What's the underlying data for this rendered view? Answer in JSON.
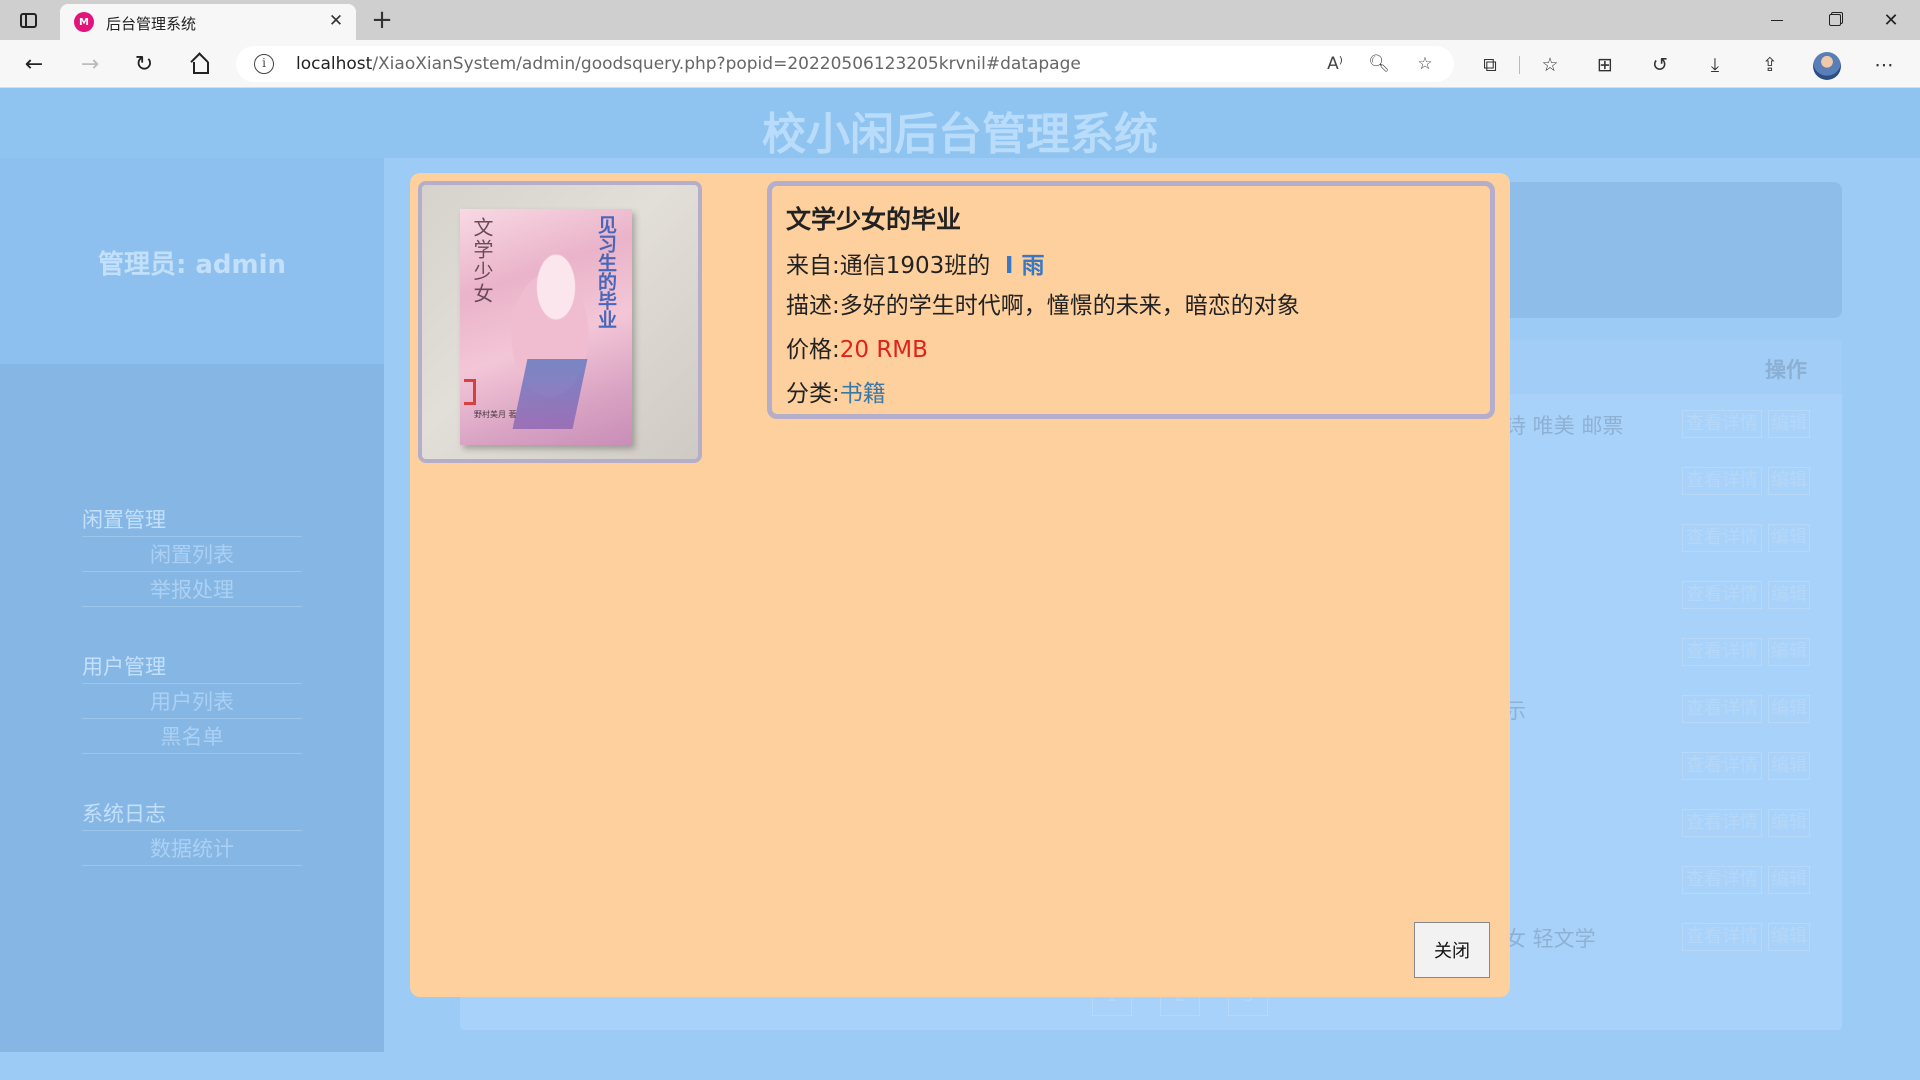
{
  "browser": {
    "tab_title": "后台管理系统",
    "favicon_text": "M",
    "url_host": "localhost",
    "url_path": "/XiaoXianSystem/admin/goodsquery.php?popid=20220506123205krvnil#datapage",
    "read_aloud_text": "A⁾"
  },
  "page": {
    "title": "校小闲后台管理系统",
    "admin_label": "管理员: admin"
  },
  "sidebar": {
    "groups": [
      {
        "heading": "闲置管理",
        "items": [
          "闲置列表",
          "举报处理"
        ]
      },
      {
        "heading": "用户管理",
        "items": [
          "用户列表",
          "黑名单"
        ]
      },
      {
        "heading": "系统日志",
        "items": [
          "数据统计"
        ]
      }
    ]
  },
  "table": {
    "op_header": "操作",
    "detail_label": "查看详情",
    "edit_label": "编辑",
    "row_texts": [
      "诗 唯美 邮票",
      "",
      "",
      "",
      "",
      "示",
      "",
      "",
      "",
      "女 轻文学"
    ],
    "pages": [
      "1",
      "2",
      "3"
    ]
  },
  "modal": {
    "goods_title": "文学少女的毕业",
    "from_label": "来自:",
    "from_class": "通信1903班的",
    "from_user": "I 雨",
    "desc_label": "描述:",
    "desc_text": "多好的学生时代啊，憧憬的未来，暗恋的对象",
    "price_label": "价格:",
    "price_value": "20 RMB",
    "category_label": "分类:",
    "category_value": "书籍",
    "close_label": "关闭",
    "book_cover": {
      "title_vertical": "文学少女",
      "subtitle_vertical": "见习生的毕业",
      "author": "野村美月 著"
    }
  },
  "colors": {
    "modal_bg": "#fdd09e",
    "price": "#e0221c",
    "link": "#3a78c2",
    "overlay_blue": "#98c8f4"
  }
}
